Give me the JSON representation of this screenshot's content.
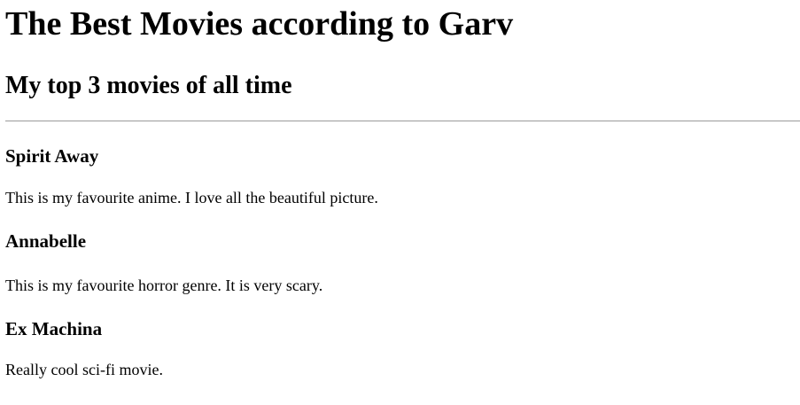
{
  "page": {
    "title": "The Best Movies according to Garv",
    "subtitle": "My top 3 movies of all time"
  },
  "movies": [
    {
      "title": "Spirit Away",
      "description": "This is my favourite anime. I love all the beautiful picture."
    },
    {
      "title": "Annabelle",
      "description": "This is my favourite horror genre. It is very scary."
    },
    {
      "title": "Ex Machina",
      "description": "Really cool sci-fi movie."
    }
  ]
}
